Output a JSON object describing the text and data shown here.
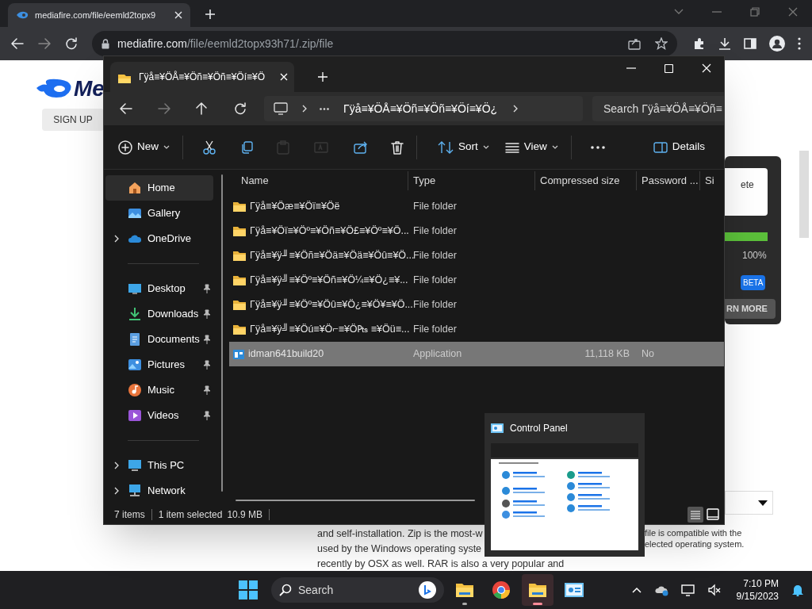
{
  "browser": {
    "tab_title": "mediafire.com/file/eemld2topx9",
    "url_host": "mediafire.com",
    "url_path": "/file/eemld2topx93h71/.zip/file"
  },
  "page": {
    "logo_text": "Me",
    "sign_up": "SIGN UP",
    "box_text": "ete",
    "progress": {
      "level": 1.0,
      "reading": "100%"
    },
    "badge": "BETA",
    "learn_more": "RN MORE",
    "left_text": [
      "and self-installation. Zip is the most-w",
      "used by the Windows operating syste",
      "recently by OSX as well. RAR is also a very popular and"
    ],
    "right_text": [
      "file is compatible with the",
      "elected operating system."
    ]
  },
  "explorer": {
    "tab_title": "Γÿå≡¥ÖÅ≡¥Öñ≡¥Öñ≡¥Öí≡¥Ö",
    "breadcrumb": "Γÿå≡¥ÖÅ≡¥Öñ≡¥Öñ≡¥Öí≡¥Ö¿",
    "search_placeholder": "Search Γÿå≡¥ÖÅ≡¥Öñ≡",
    "toolbar": [
      {
        "kind": "new",
        "label": "New",
        "disabled": false
      },
      {
        "kind": "cut",
        "disabled": false
      },
      {
        "kind": "copy",
        "disabled": false
      },
      {
        "kind": "paste",
        "disabled": true
      },
      {
        "kind": "rename",
        "disabled": true
      },
      {
        "kind": "share",
        "disabled": false
      },
      {
        "kind": "delete",
        "disabled": false
      },
      {
        "kind": "sort",
        "label": "Sort",
        "disabled": false
      },
      {
        "kind": "view",
        "label": "View",
        "disabled": false
      },
      {
        "kind": "more",
        "disabled": false
      },
      {
        "kind": "details",
        "label": "Details",
        "disabled": false
      }
    ],
    "sidebar": [
      {
        "kind": "home",
        "label": "Home",
        "selected": true,
        "pinned": false
      },
      {
        "kind": "gallery",
        "label": "Gallery",
        "selected": false,
        "pinned": false
      },
      {
        "kind": "cloud",
        "label": "OneDrive",
        "selected": false,
        "pinned": false,
        "expanded": false
      },
      {
        "kind": "separator"
      },
      {
        "kind": "desktop",
        "label": "Desktop",
        "selected": false,
        "pinned": true
      },
      {
        "kind": "downloads",
        "label": "Downloads",
        "selected": false,
        "pinned": true
      },
      {
        "kind": "documents",
        "label": "Documents",
        "selected": false,
        "pinned": true
      },
      {
        "kind": "pictures",
        "label": "Pictures",
        "selected": false,
        "pinned": true
      },
      {
        "kind": "music",
        "label": "Music",
        "selected": false,
        "pinned": true
      },
      {
        "kind": "videos",
        "label": "Videos",
        "selected": false,
        "pinned": true
      },
      {
        "kind": "separator"
      },
      {
        "kind": "pc",
        "label": "This PC",
        "selected": false,
        "pinned": false,
        "expanded": false
      },
      {
        "kind": "network",
        "label": "Network",
        "selected": false,
        "pinned": false,
        "expanded": false
      }
    ],
    "columns": [
      "Name",
      "Type",
      "Compressed size",
      "Password ...",
      "Si"
    ],
    "rows": [
      {
        "kind": "folder",
        "name": "Γÿå≡¥Öæ≡¥Öï≡¥Öë",
        "type": "File folder",
        "selected": false
      },
      {
        "kind": "folder",
        "name": "Γÿå≡¥Öï≡¥Öº≡¥Öñ≡¥Ö£≡¥Öº≡¥Ö...",
        "type": "File folder",
        "selected": false
      },
      {
        "kind": "folder",
        "name": "Γÿå≡¥ÿ╜≡¥Öñ≡¥Öä≡¥Öä≡¥Öû≡¥Ö...",
        "type": "File folder",
        "selected": false
      },
      {
        "kind": "folder",
        "name": "Γÿå≡¥ÿ╝≡¥Öº≡¥Öñ≡¥Ö¼≡¥Ö¿≡¥...",
        "type": "File folder",
        "selected": false
      },
      {
        "kind": "folder",
        "name": "Γÿå≡¥ÿ╜≡¥Öº≡¥Öû≡¥Ö¿≡¥Ö¥≡¥Ö...",
        "type": "File folder",
        "selected": false
      },
      {
        "kind": "folder",
        "name": "Γÿå≡¥ÿ╝≡¥Öú≡¥Ö⌐≡¥Ö₧ ≡¥Öü≡...",
        "type": "File folder",
        "selected": false
      },
      {
        "kind": "app",
        "name": "idman641build20",
        "type": "Application",
        "size": "11,118 KB",
        "password": "No",
        "selected": true
      }
    ],
    "status": {
      "count": "7 items",
      "selection": "1 item selected",
      "size": "10.9 MB"
    }
  },
  "preview": {
    "title": "Control Panel"
  },
  "taskbar": {
    "search": "Search",
    "apps": [
      {
        "kind": "folder",
        "running": true,
        "selected": false
      },
      {
        "kind": "chrome",
        "running": false,
        "selected": false
      },
      {
        "kind": "folder",
        "running": true,
        "selected": true
      },
      {
        "kind": "control",
        "running": false,
        "selected": false
      }
    ],
    "time": "7:10 PM",
    "date": "9/15/2023"
  }
}
